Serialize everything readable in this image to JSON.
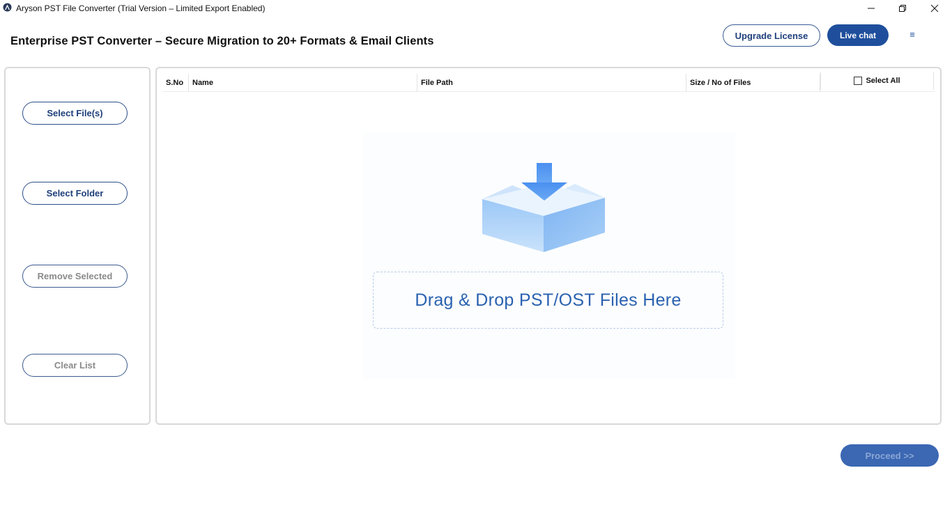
{
  "window": {
    "title": "Aryson PST File Converter (Trial Version – Limited Export Enabled)",
    "controls": {
      "minimize": "—",
      "maximize": "❐",
      "close": "✕"
    }
  },
  "header": {
    "headline": "Enterprise PST Converter – Secure Migration to 20+ Formats & Email Clients",
    "upgrade_label": "Upgrade License",
    "live_chat_label": "Live chat",
    "menu_glyph": "≡"
  },
  "sidebar": {
    "items": [
      {
        "label": "Select File(s)",
        "enabled": true
      },
      {
        "label": "Select Folder",
        "enabled": true
      },
      {
        "label": "Remove Selected",
        "enabled": false
      },
      {
        "label": "Clear List",
        "enabled": false
      }
    ]
  },
  "grid": {
    "columns": [
      "S.No",
      "Name",
      "File Path",
      "Size / No of Files"
    ],
    "select_all_label": "Select All",
    "select_all_checked": false
  },
  "dropzone": {
    "text": "Drag & Drop PST/OST Files Here",
    "icon": "download-box-icon"
  },
  "footer": {
    "proceed_label": "Proceed >>"
  },
  "colors": {
    "primary": "#1f4f9c",
    "drop_text": "#2a62b0",
    "panel_border": "#d9d9d9"
  }
}
